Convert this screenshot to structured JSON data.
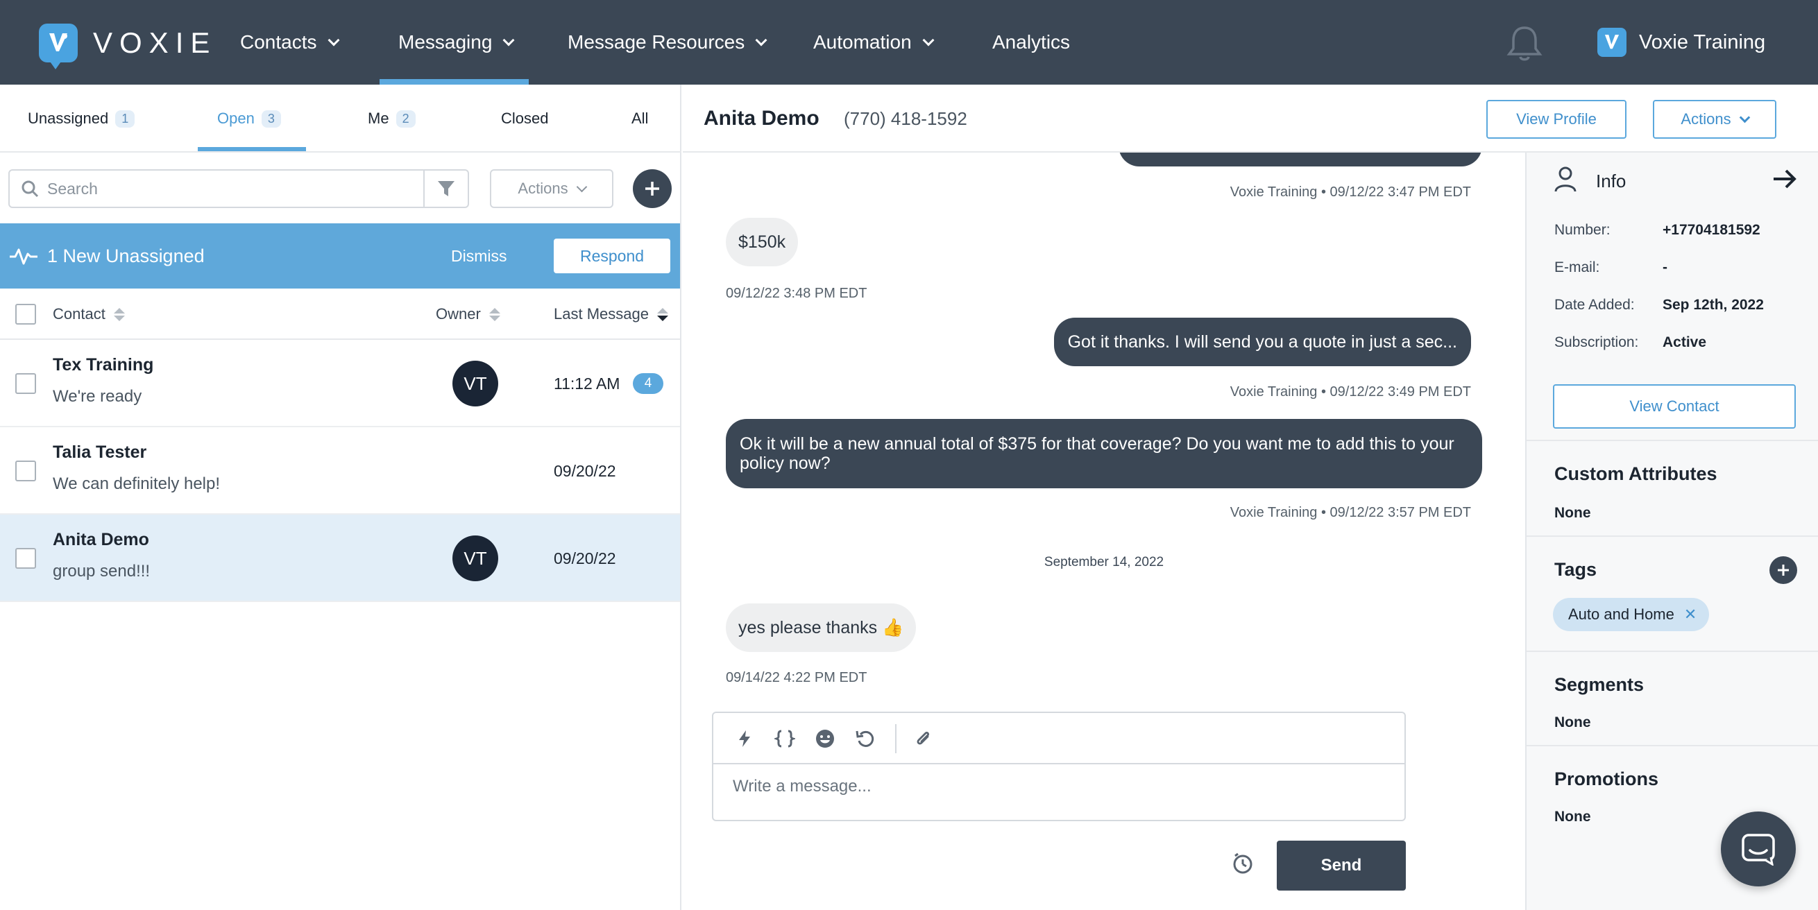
{
  "app": {
    "logo_text": "VOXIE",
    "account_name": "Voxie Training"
  },
  "nav": [
    {
      "label": "Contacts",
      "has_menu": true
    },
    {
      "label": "Messaging",
      "has_menu": true,
      "active": true
    },
    {
      "label": "Message Resources",
      "has_menu": true
    },
    {
      "label": "Automation",
      "has_menu": true
    },
    {
      "label": "Analytics",
      "has_menu": false
    }
  ],
  "inbox_tabs": [
    {
      "label": "Unassigned",
      "count": "1"
    },
    {
      "label": "Open",
      "count": "3",
      "active": true
    },
    {
      "label": "Me",
      "count": "2"
    },
    {
      "label": "Closed",
      "count": ""
    },
    {
      "label": "All",
      "count": ""
    }
  ],
  "search": {
    "placeholder": "Search",
    "value": ""
  },
  "list_actions_label": "Actions",
  "banner": {
    "text": "1 New Unassigned",
    "dismiss": "Dismiss",
    "respond": "Respond"
  },
  "table": {
    "col_contact": "Contact",
    "col_owner": "Owner",
    "col_last": "Last Message"
  },
  "conversations": [
    {
      "name": "Tex Training",
      "snippet": "We're ready",
      "owner": "VT",
      "time": "11:12 AM",
      "unread": "4"
    },
    {
      "name": "Talia Tester",
      "snippet": "We can definitely help!",
      "owner": "",
      "time": "09/20/22",
      "unread": ""
    },
    {
      "name": "Anita Demo",
      "snippet": "group send!!!",
      "owner": "VT",
      "time": "09/20/22",
      "unread": "",
      "selected": true
    }
  ],
  "chat": {
    "contact_name": "Anita Demo",
    "contact_phone": "(770) 418-1592",
    "view_profile": "View Profile",
    "actions": "Actions",
    "messages": [
      {
        "dir": "out",
        "text": "",
        "meta": "Voxie Training • 09/12/22 3:47 PM EDT"
      },
      {
        "dir": "in",
        "text": "$150k",
        "meta": "09/12/22 3:48 PM EDT"
      },
      {
        "dir": "out",
        "text": "Got it thanks. I will send you a quote in just a sec...",
        "meta": "Voxie Training • 09/12/22 3:49 PM EDT"
      },
      {
        "dir": "out",
        "text": "Ok it will be a new annual total of $375 for that coverage? Do you want me to add this to your policy now?",
        "meta": "Voxie Training • 09/12/22 3:57 PM EDT"
      },
      {
        "dir": "in",
        "text": "yes please thanks 👍",
        "meta": "09/14/22 4:22 PM EDT"
      }
    ],
    "date_separator": "September 14, 2022",
    "composer_placeholder": "Write a message...",
    "send_label": "Send"
  },
  "info": {
    "title": "Info",
    "number_label": "Number:",
    "number": "+17704181592",
    "email_label": "E-mail:",
    "email": "-",
    "date_label": "Date Added:",
    "date": "Sep 12th, 2022",
    "sub_label": "Subscription:",
    "sub": "Active",
    "view_contact": "View Contact",
    "custom_title": "Custom Attributes",
    "custom_val": "None",
    "tags_title": "Tags",
    "tags": [
      "Auto and Home"
    ],
    "segments_title": "Segments",
    "segments_val": "None",
    "promos_title": "Promotions",
    "promos_val": "None"
  },
  "colors": {
    "nav_bg": "#3b4755",
    "accent": "#5ba8dd",
    "banner": "#5fa8da",
    "outgoing_bubble": "#3b4755",
    "incoming_bubble": "#eeeff0"
  }
}
